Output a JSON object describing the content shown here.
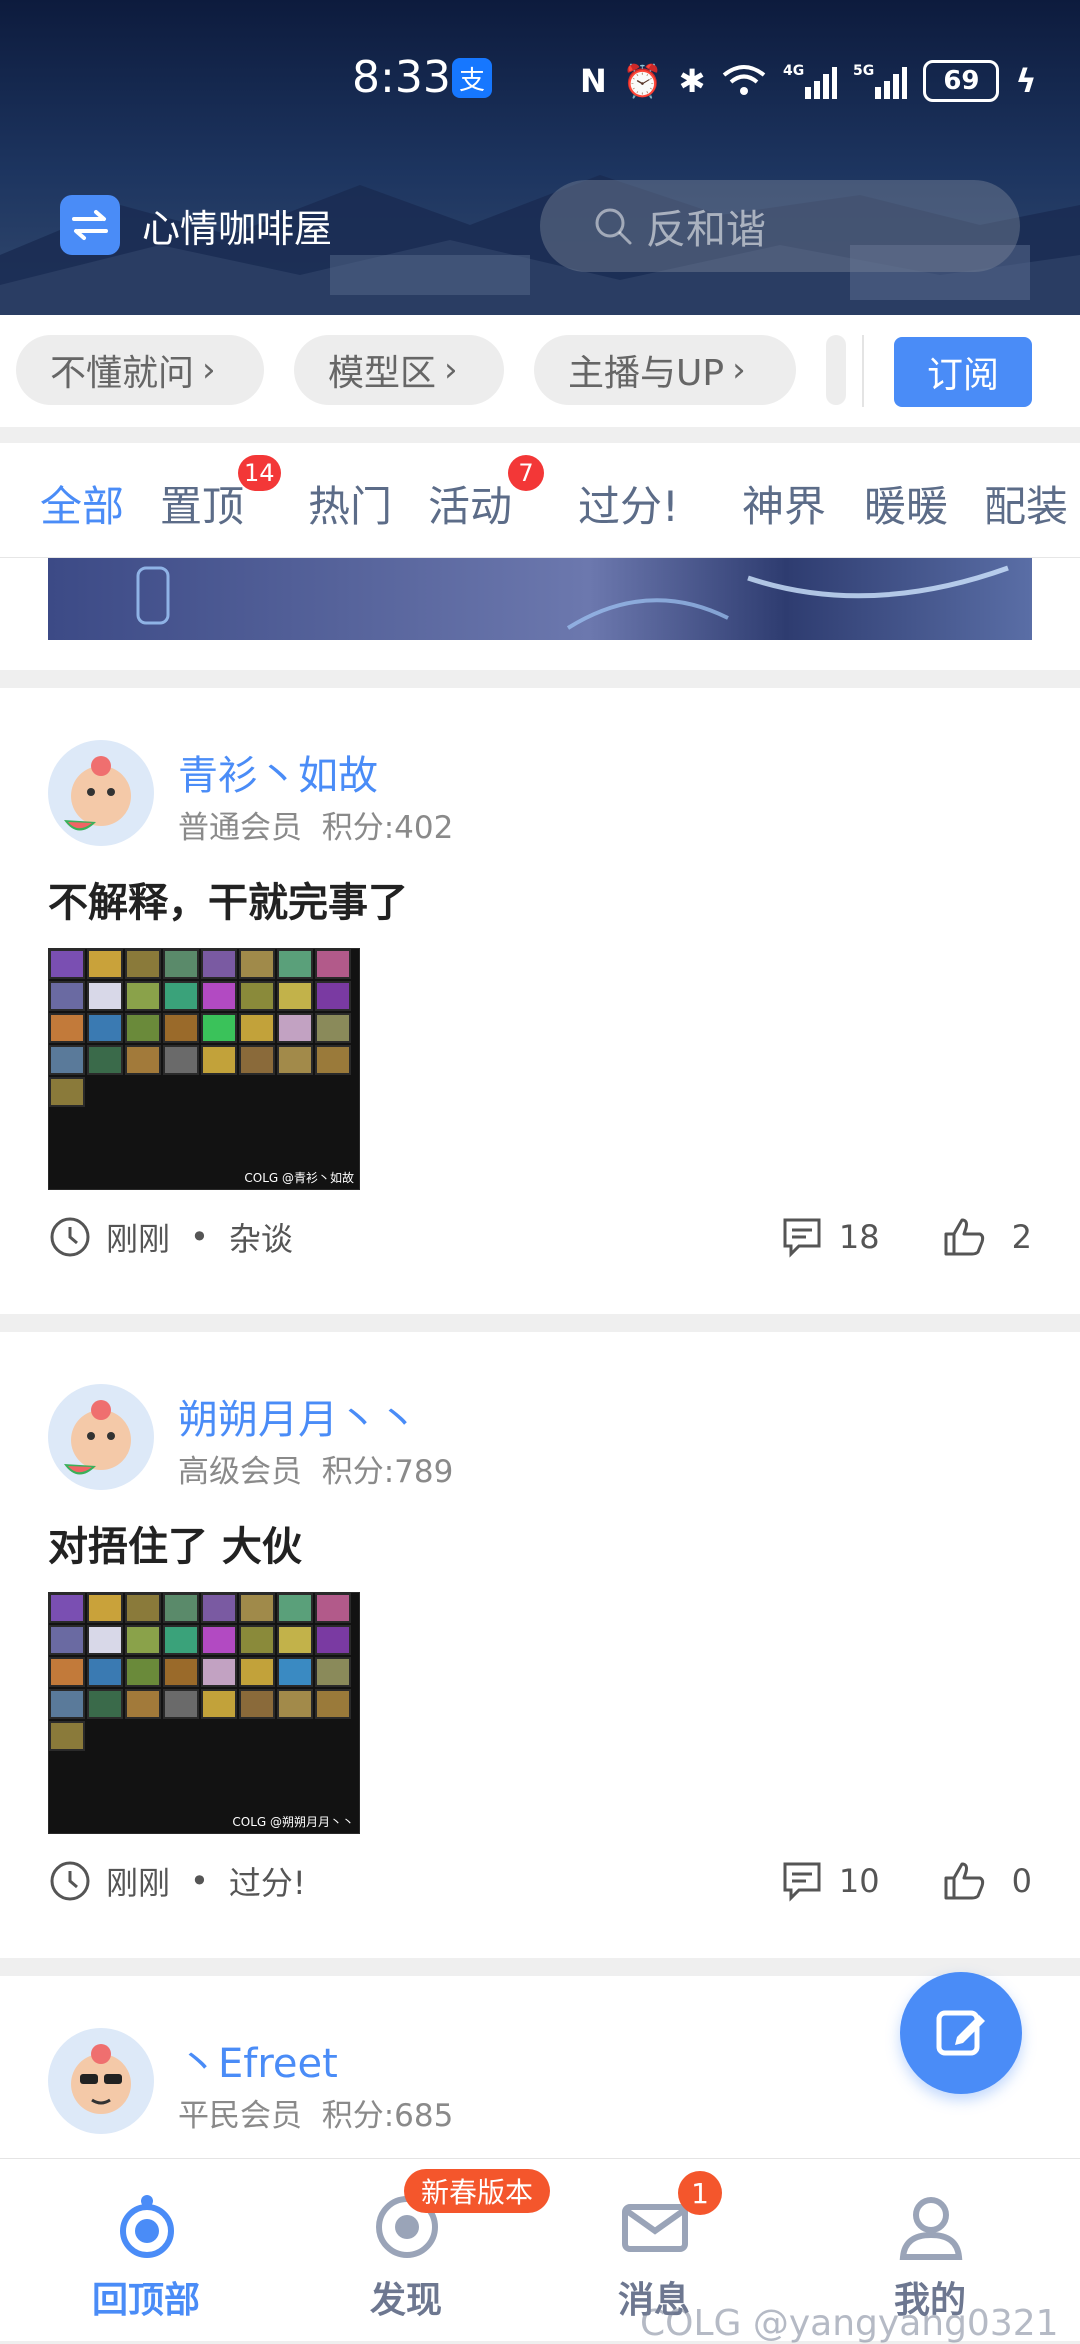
{
  "status_bar": {
    "time": "8:33",
    "alipay_icon": "支",
    "battery": "69"
  },
  "header": {
    "app_title": "心情咖啡屋",
    "search_placeholder": "反和谐"
  },
  "chips": [
    {
      "label": "不懂就问"
    },
    {
      "label": "模型区"
    },
    {
      "label": "主播与UP"
    }
  ],
  "subscribe_label": "订阅",
  "tabs": [
    {
      "label": "全部",
      "active": true
    },
    {
      "label": "置顶",
      "badge": "14"
    },
    {
      "label": "热门"
    },
    {
      "label": "活动",
      "badge": "7"
    },
    {
      "label": "过分!"
    },
    {
      "label": "神界"
    },
    {
      "label": "暖暖"
    },
    {
      "label": "配装"
    }
  ],
  "posts": [
    {
      "username": "青衫丶如故",
      "member_level": "普通会员",
      "points": "积分:402",
      "title": "不解释，干就完事了",
      "image_watermark": "COLG @青衫丶如故",
      "time": "刚刚",
      "section": "杂谈",
      "comments": "18",
      "likes": "2"
    },
    {
      "username": "朔朔月月丶丶",
      "member_level": "高级会员",
      "points": "积分:789",
      "title": "对捂住了 大伙",
      "image_watermark": "COLG @朔朔月月丶丶",
      "time": "刚刚",
      "section": "过分!",
      "comments": "10",
      "likes": "0"
    },
    {
      "username": "丶Efreet",
      "member_level": "平民会员",
      "points": "积分:685"
    }
  ],
  "bottom_nav": [
    {
      "label": "回顶部",
      "active": true
    },
    {
      "label": "发现",
      "badge": "新春版本"
    },
    {
      "label": "消息",
      "badge": "1"
    },
    {
      "label": "我的"
    }
  ],
  "watermark": "COLG @yangyang0321",
  "colors": {
    "accent": "#4a8cf7",
    "badge_red": "#f33737",
    "badge_orange": "#f4562c"
  }
}
